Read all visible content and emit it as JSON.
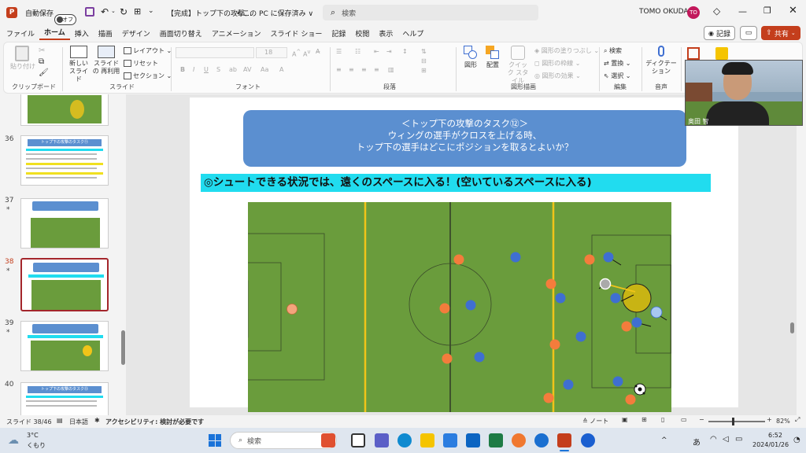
{
  "titlebar": {
    "autosave_label": "自動保存",
    "autosave_state": "オフ",
    "doc_title": "【完成】トップ下の攻撃…",
    "save_status": "• この PC に保存済み ∨",
    "search_placeholder": "検索",
    "user_name": "TOMO OKUDA",
    "user_initials": "TO"
  },
  "menu": {
    "tabs": [
      "ファイル",
      "ホーム",
      "挿入",
      "描画",
      "デザイン",
      "画面切り替え",
      "アニメーション",
      "スライド ショー",
      "記録",
      "校閲",
      "表示",
      "ヘルプ"
    ],
    "active_tab": "ホーム",
    "record_btn": "記録",
    "share_btn": "共有"
  },
  "ribbon": {
    "paste": "貼り付け",
    "clipboard_group": "クリップボード",
    "new_slide": "新しい スライド",
    "reuse_slide": "スライドの 再利用",
    "layout": "レイアウト",
    "reset": "リセット",
    "section": "セクション",
    "slide_group": "スライド",
    "font_size": "18",
    "font_group": "フォント",
    "paragraph_group": "段落",
    "shapes": "図形",
    "arrange": "配置",
    "quick_style": "クイック スタイル",
    "fill": "図形の塗りつぶし",
    "outline": "図形の枠線",
    "effects": "図形の効果",
    "drawing_group": "図形描画",
    "find": "検索",
    "replace": "置換",
    "select": "選択",
    "edit_group": "編集",
    "dictation": "ディクテー ション",
    "voice_group": "音声"
  },
  "thumbnails": {
    "numbers": [
      "36",
      "37",
      "38",
      "39",
      "40"
    ],
    "star": "*",
    "thumb_title_36": "トップ下の攻撃のタスク⑪",
    "thumb_title_40": "トップ下の攻撃のタスク⑬"
  },
  "slide": {
    "banner_line1": "＜トップ下の攻撃のタスク⑫＞",
    "banner_line2": "ウィングの選手がクロスを上げる時、",
    "banner_line3": "トップ下の選手はどこにポジションを取るとよいか？",
    "subtitle": "◎シュートできる状況では、遠くのスペースに入る！(空いているスペースに入る)"
  },
  "camera": {
    "name_label": "奥田 智"
  },
  "statusbar": {
    "slide_info": "スライド 38/46",
    "language": "日本語",
    "accessibility": "アクセシビリティ: 検討が必要です",
    "notes": "ノート",
    "zoom": "82%"
  },
  "taskbar": {
    "weather_temp": "3°C",
    "weather_desc": "くもり",
    "search": "検索",
    "ime": "あ",
    "time": "6:52",
    "date": "2024/01/26"
  },
  "colors": {
    "accent": "#c43e1c",
    "banner": "#5b8fd0",
    "subtitle_bg": "#21dcef",
    "pitch": "#6a9c3c",
    "orange_player": "#f47c3c",
    "blue_player": "#3f6fd1",
    "yellow_line": "#f0c419"
  }
}
